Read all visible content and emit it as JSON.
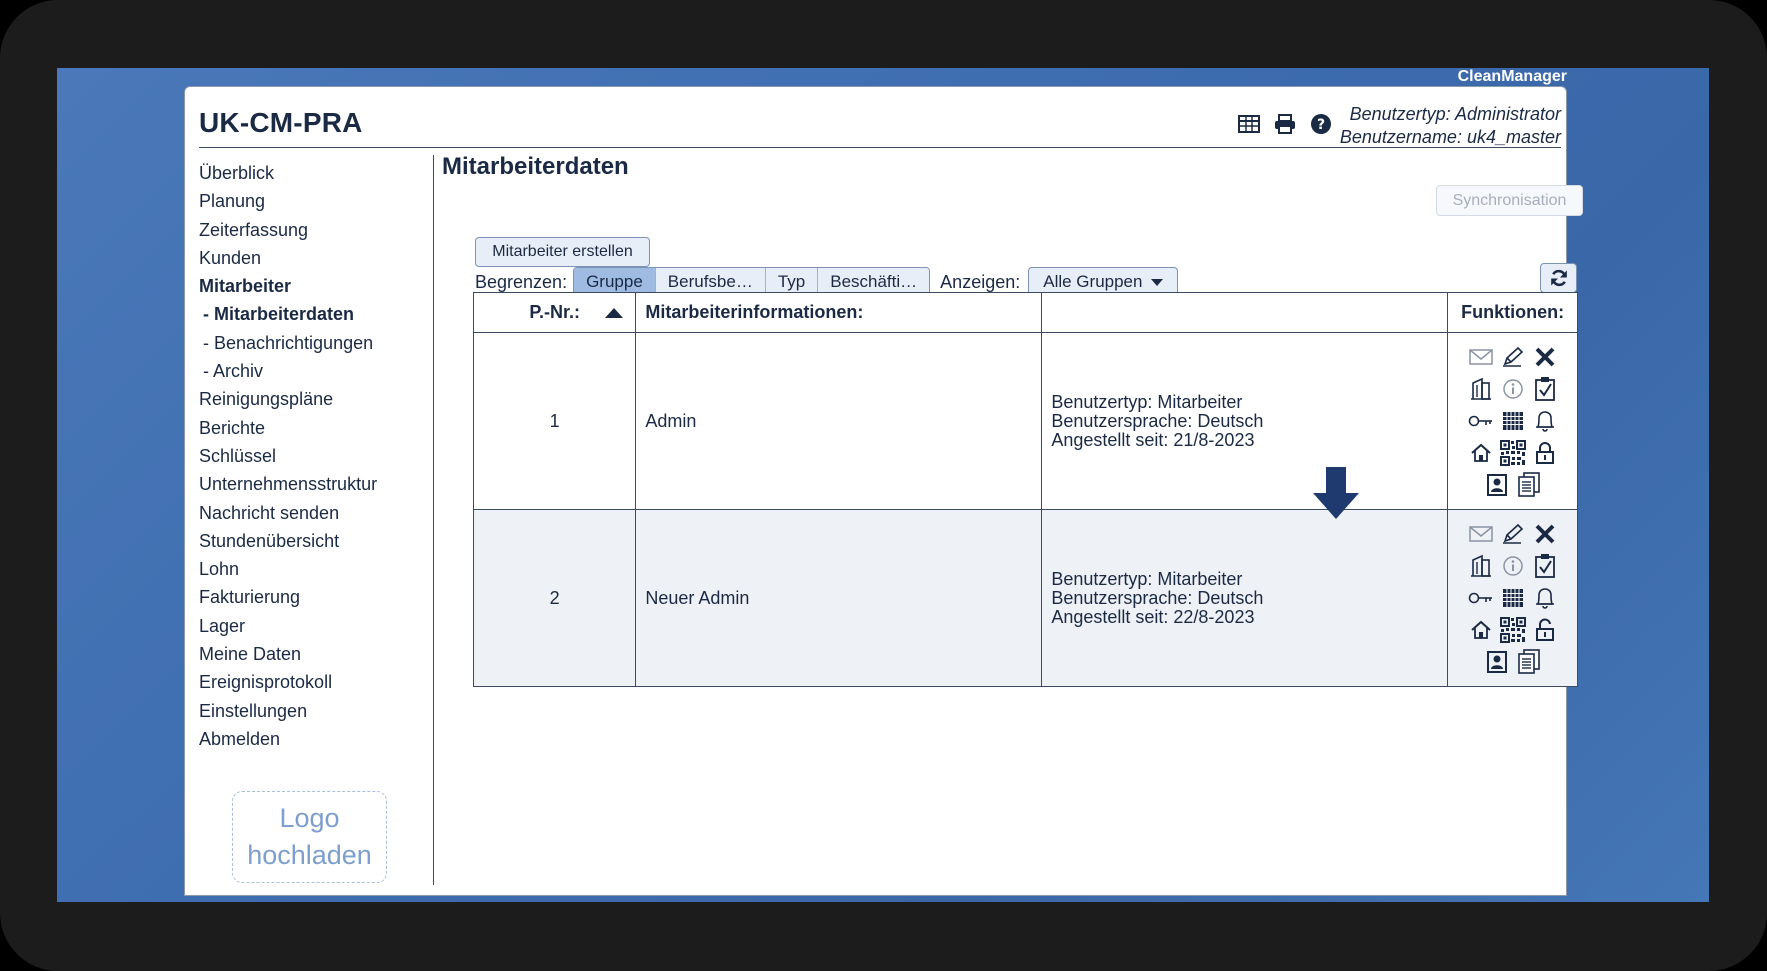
{
  "app": {
    "brand": "CleanManager",
    "org": "UK-CM-PRA"
  },
  "user": {
    "type": "Benutzertyp: Administrator",
    "name": "Benutzername: uk4_master"
  },
  "header_icons": [
    "table-icon",
    "print-icon",
    "help-icon"
  ],
  "nav": [
    {
      "label": "Überblick",
      "bold": false,
      "sub": false
    },
    {
      "label": "Planung",
      "bold": false,
      "sub": false
    },
    {
      "label": "Zeiterfassung",
      "bold": false,
      "sub": false
    },
    {
      "label": "Kunden",
      "bold": false,
      "sub": false
    },
    {
      "label": "Mitarbeiter",
      "bold": true,
      "sub": false
    },
    {
      "label": "- Mitarbeiterdaten",
      "bold": true,
      "sub": true
    },
    {
      "label": "- Benachrichtigungen",
      "bold": false,
      "sub": true
    },
    {
      "label": "- Archiv",
      "bold": false,
      "sub": true
    },
    {
      "label": "Reinigungspläne",
      "bold": false,
      "sub": false
    },
    {
      "label": "Berichte",
      "bold": false,
      "sub": false
    },
    {
      "label": "Schlüssel",
      "bold": false,
      "sub": false
    },
    {
      "label": "Unternehmensstruktur",
      "bold": false,
      "sub": false
    },
    {
      "label": "Nachricht senden",
      "bold": false,
      "sub": false
    },
    {
      "label": "Stundenübersicht",
      "bold": false,
      "sub": false
    },
    {
      "label": "Lohn",
      "bold": false,
      "sub": false
    },
    {
      "label": "Fakturierung",
      "bold": false,
      "sub": false
    },
    {
      "label": "Lager",
      "bold": false,
      "sub": false
    },
    {
      "label": "Meine Daten",
      "bold": false,
      "sub": false
    },
    {
      "label": "Ereignisprotokoll",
      "bold": false,
      "sub": false
    },
    {
      "label": "Einstellungen",
      "bold": false,
      "sub": false
    },
    {
      "label": "Abmelden",
      "bold": false,
      "sub": false
    }
  ],
  "logo_upload": {
    "line1": "Logo",
    "line2": "hochladen"
  },
  "page": {
    "title": "Mitarbeiterdaten",
    "sync_label": "Synchronisation",
    "create_label": "Mitarbeiter erstellen",
    "filter_label": "Begrenzen:",
    "filter_tabs": [
      "Gruppe",
      "Berufsbe…",
      "Typ",
      "Beschäfti…"
    ],
    "filter_active": 0,
    "show_label": "Anzeigen:",
    "show_value": "Alle Gruppen"
  },
  "table": {
    "headers": {
      "pnr": "P.-Nr.:",
      "info": "Mitarbeiterinformationen:",
      "empty": "",
      "functions": "Funktionen:"
    },
    "rows": [
      {
        "pnr": "1",
        "name": "Admin",
        "details": [
          "Benutzertyp: Mitarbeiter",
          "Benutzersprache: Deutsch",
          "Angestellt seit: 21/8-2023"
        ],
        "lock": "lock-closed-icon"
      },
      {
        "pnr": "2",
        "name": "Neuer Admin",
        "details": [
          "Benutzertyp: Mitarbeiter",
          "Benutzersprache: Deutsch",
          "Angestellt seit: 22/8-2023"
        ],
        "lock": "lock-open-icon"
      }
    ],
    "function_icons": [
      "mail-icon",
      "edit-icon",
      "delete-icon",
      "building-icon",
      "info-icon",
      "clipboard-check-icon",
      "key-icon",
      "calendar-grid-icon",
      "bell-icon",
      "home-icon",
      "qr-code-icon",
      "lock-icon",
      "id-card-icon",
      "documents-icon"
    ]
  },
  "colors": {
    "accent": "#1b2a44",
    "active_tab": "#9fbbe2",
    "desktop": "#4a78b8"
  }
}
